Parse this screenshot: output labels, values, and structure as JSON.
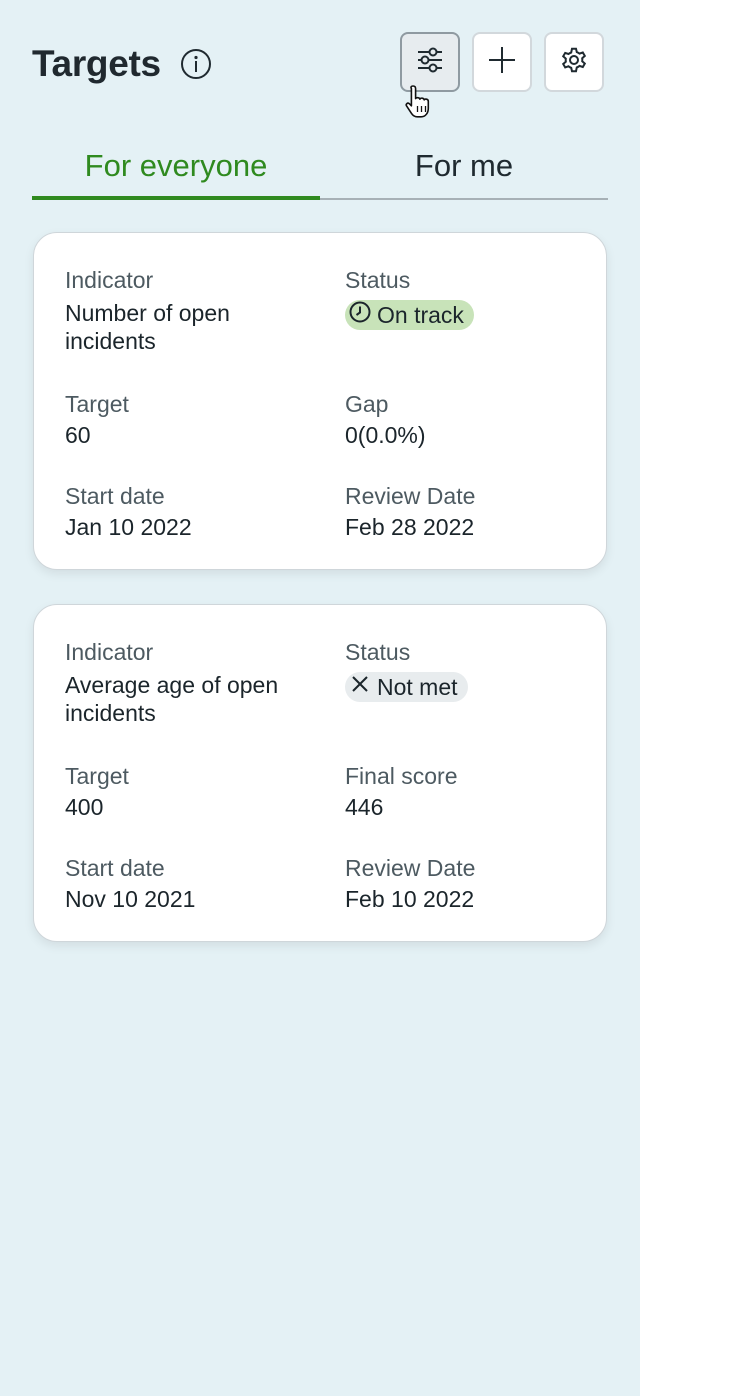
{
  "header": {
    "title": "Targets"
  },
  "icons": {
    "info": "info-icon",
    "filter": "sliders-icon",
    "add": "plus-icon",
    "settings": "gear-icon"
  },
  "tabs": [
    {
      "label": "For everyone",
      "active": true
    },
    {
      "label": "For me",
      "active": false
    }
  ],
  "cards": [
    {
      "indicator_label": "Indicator",
      "indicator_value": "Number of open incidents",
      "status_label": "Status",
      "status_value": "On track",
      "target_label": "Target",
      "target_value": "60",
      "metric_label": "Gap",
      "metric_value": "0(0.0%)",
      "start_label": "Start date",
      "start_value": "Jan 10 2022",
      "review_label": "Review Date",
      "review_value": "Feb 28 2022"
    },
    {
      "indicator_label": "Indicator",
      "indicator_value": "Average age of open incidents",
      "status_label": "Status",
      "status_value": "Not met",
      "target_label": "Target",
      "target_value": "400",
      "metric_label": "Final score",
      "metric_value": "446",
      "start_label": "Start date",
      "start_value": "Nov 10 2021",
      "review_label": "Review Date",
      "review_value": "Feb 10 2022"
    }
  ],
  "colors": {
    "panel_bg": "#e4f1f5",
    "accent_green": "#2f8a1f",
    "on_track_badge": "#c8e3b9",
    "not_met_badge": "#e8ecee"
  }
}
